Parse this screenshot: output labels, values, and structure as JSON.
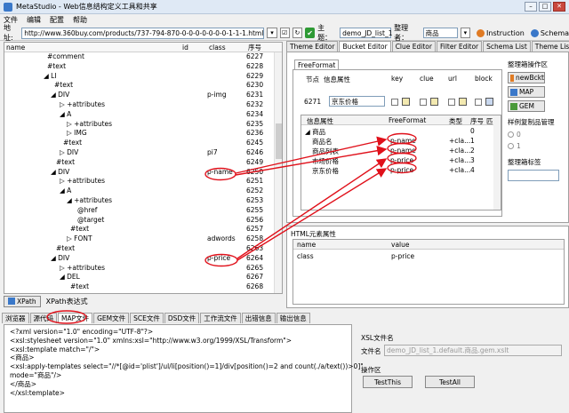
{
  "window": {
    "title": "MetaStudio - Web信息结构定义工具和共享"
  },
  "menu": [
    "文件",
    "编辑",
    "配置",
    "帮助"
  ],
  "address": {
    "label": "地址:",
    "url": "http://www.360buy.com/products/737-794-870-0-0-0-0-0-0-0-1-1-1.html",
    "topic_label": "主题：",
    "topic_value": "demo_JD_list_1",
    "organizer_label": "整理者：",
    "organizer_value": "商品",
    "instruction": "Instruction",
    "schema": "Schema"
  },
  "tree": {
    "headers": [
      "name",
      "id",
      "class",
      "序号"
    ],
    "rows": [
      {
        "name": "#comment",
        "indent": 48,
        "cls": "",
        "no": "6227"
      },
      {
        "name": "#text",
        "indent": 48,
        "cls": "",
        "no": "6228"
      },
      {
        "name": "◢ LI",
        "indent": 44,
        "cls": "",
        "no": "6229"
      },
      {
        "name": "#text",
        "indent": 56,
        "cls": "",
        "no": "6230"
      },
      {
        "name": "◢ DIV",
        "indent": 52,
        "cls": "p-img",
        "no": "6231"
      },
      {
        "name": "▷ +attributes",
        "indent": 62,
        "cls": "",
        "no": "6232"
      },
      {
        "name": "◢ A",
        "indent": 62,
        "cls": "",
        "no": "6234"
      },
      {
        "name": "▷ +attributes",
        "indent": 70,
        "cls": "",
        "no": "6235"
      },
      {
        "name": "▷ IMG",
        "indent": 70,
        "cls": "",
        "no": "6236"
      },
      {
        "name": "#text",
        "indent": 66,
        "cls": "",
        "no": "6245"
      },
      {
        "name": "▷ DIV",
        "indent": 62,
        "cls": "pi7",
        "no": "6246"
      },
      {
        "name": "#text",
        "indent": 58,
        "cls": "",
        "no": "6249"
      },
      {
        "name": "◢ DIV",
        "indent": 52,
        "cls": "p-name",
        "no": "6250"
      },
      {
        "name": "▷ +attributes",
        "indent": 62,
        "cls": "",
        "no": "6251"
      },
      {
        "name": "◢ A",
        "indent": 62,
        "cls": "",
        "no": "6252"
      },
      {
        "name": "◢ +attributes",
        "indent": 70,
        "cls": "",
        "no": "6253"
      },
      {
        "name": "@href",
        "indent": 82,
        "cls": "",
        "no": "6255"
      },
      {
        "name": "@target",
        "indent": 82,
        "cls": "",
        "no": "6256"
      },
      {
        "name": "#text",
        "indent": 74,
        "cls": "",
        "no": "6257"
      },
      {
        "name": "▷ FONT",
        "indent": 70,
        "cls": "adwords",
        "no": "6258"
      },
      {
        "name": "#text",
        "indent": 58,
        "cls": "",
        "no": "6263"
      },
      {
        "name": "◢ DIV",
        "indent": 52,
        "cls": "p-price",
        "no": "6264"
      },
      {
        "name": "▷ +attributes",
        "indent": 62,
        "cls": "",
        "no": "6265"
      },
      {
        "name": "◢ DEL",
        "indent": 62,
        "cls": "",
        "no": "6267"
      },
      {
        "name": "#text",
        "indent": 74,
        "cls": "",
        "no": "6268"
      }
    ]
  },
  "xpath": {
    "button": "XPath",
    "label": "XPath表达式"
  },
  "right_tabs": [
    "Theme Editor",
    "Bucket Editor",
    "Clue Editor",
    "Filter Editor",
    "Schema List",
    "Theme List"
  ],
  "right_active_tab": 1,
  "freeformat": {
    "tab": "FreeFormat",
    "headers": [
      "节点",
      "信息属性",
      "key",
      "clue",
      "url",
      "block"
    ],
    "node_no": "6271",
    "node_attr": "京东价格",
    "grid_headers": [
      "信息属性",
      "FreeFormat",
      "类型",
      "序号",
      "匹"
    ],
    "root": "商品",
    "root_no": "0",
    "rows": [
      {
        "name": "商品名",
        "ff": "p-name",
        "type": "+cla...",
        "no": "1"
      },
      {
        "name": "商品列表",
        "ff": "p-name",
        "type": "+cla...",
        "no": "2"
      },
      {
        "name": "市场价格",
        "ff": "p-price",
        "type": "+cla...",
        "no": "3"
      },
      {
        "name": "京东价格",
        "ff": "p-price",
        "type": "+cla...",
        "no": "4"
      }
    ]
  },
  "right_side": {
    "ops_title": "整理箱操作区",
    "buttons": [
      "newBckt",
      "MAP",
      "GEM"
    ],
    "sample_title": "样例复制品管理",
    "radios": [
      "0",
      "1"
    ],
    "tag_title": "整理箱标签"
  },
  "html_attrs": {
    "title": "HTML元素属性",
    "headers": [
      "name",
      "value"
    ],
    "rows": [
      {
        "name": "class",
        "value": "p-price"
      }
    ]
  },
  "bottom_tabs": [
    "浏览器",
    "源代码",
    "MAP文件",
    "GEM文件",
    "SCE文件",
    "DSD文件",
    "工作流文件",
    "出错信息",
    "输出信息"
  ],
  "bottom_active_tab": 2,
  "map_code": [
    "<?xml version=\"1.0\" encoding=\"UTF-8\"?>",
    "<xsl:stylesheet version=\"1.0\" xmlns:xsl=\"http://www.w3.org/1999/XSL/Transform\">",
    "<xsl:template match=\"/\">",
    "<商品>",
    "<xsl:apply-templates select=\"//*[@id='plist']/ul/li[position()=1]/div[position()=2 and count(./a/text())>0]\"",
    "mode=\"商品\"/>",
    "</商品>",
    "</xsl:template>"
  ],
  "xsl": {
    "title": "XSL文件名",
    "file_label": "文件名",
    "file_value": "demo_JD_list_1.default.商品.gem.xslt",
    "ops_label": "操作区",
    "test_this": "TestThis",
    "test_all": "TestAll"
  },
  "annotation_color": "#e0101a"
}
